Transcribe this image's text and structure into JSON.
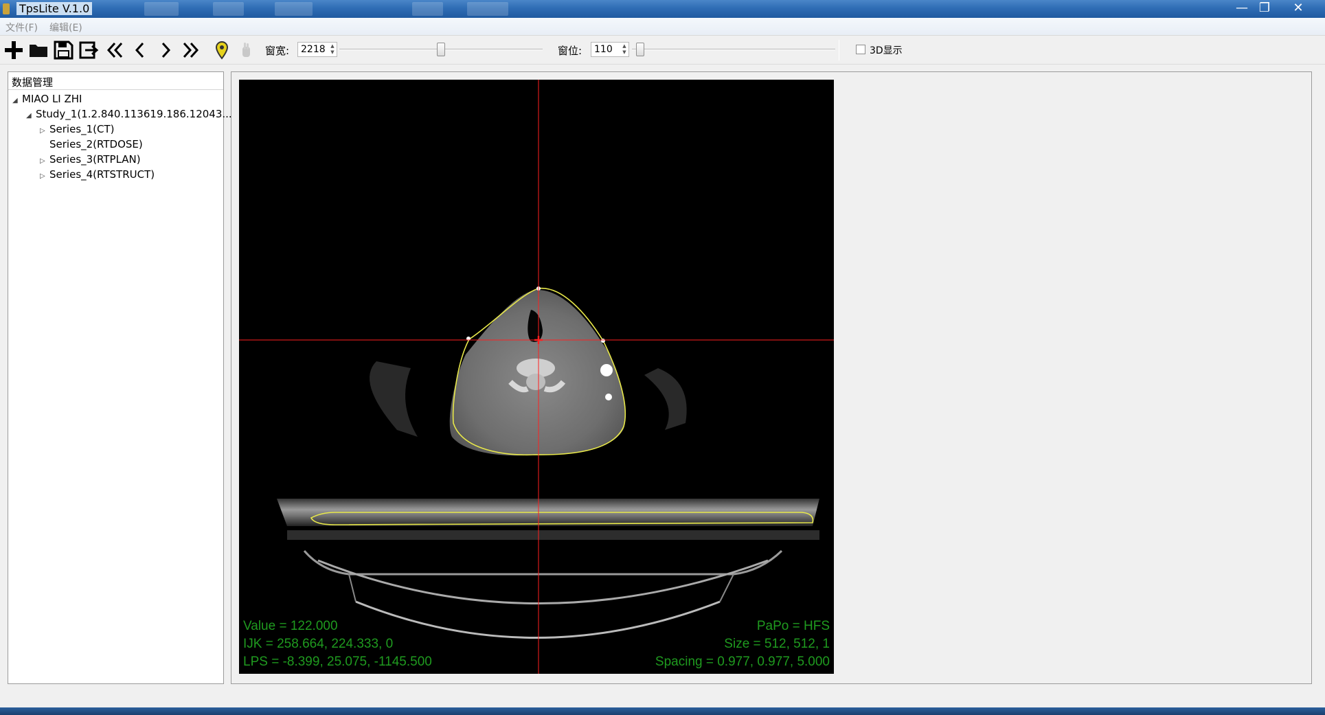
{
  "window": {
    "title": "TpsLite V.1.0",
    "controls": {
      "minimize": "—",
      "maximize": "❐",
      "close": "✕"
    }
  },
  "menu": {
    "items": [
      "文件(F)",
      "编辑(E)"
    ]
  },
  "toolbar": {
    "window_width_label": "窗宽:",
    "window_width_value": "2218",
    "window_width_slider": 0.5,
    "window_level_label": "窗位:",
    "window_level_value": "110",
    "window_level_slider": 0.02,
    "show3d_label": "3D显示",
    "show3d_checked": false,
    "icons": [
      "add-icon",
      "open-folder-icon",
      "save-icon",
      "export-icon",
      "first-icon",
      "previous-icon",
      "next-icon",
      "last-icon",
      "marker-icon",
      "hand-icon"
    ]
  },
  "data_panel": {
    "title": "数据管理",
    "patient": "MIAO LI ZHI",
    "study": "Study_1(1.2.840.113619.186.12043...",
    "series": [
      "Series_1(CT)",
      "Series_2(RTDOSE)",
      "Series_3(RTPLAN)",
      "Series_4(RTSTRUCT)"
    ]
  },
  "viewer": {
    "value": "Value = 122.000",
    "ijk": "IJK = 258.664, 224.333, 0",
    "lps": "LPS = -8.399, 25.075, -1145.500",
    "papo": "PaPo = HFS",
    "size": "Size = 512, 512, 1",
    "spacing": "Spacing = 0.977, 0.977, 5.000",
    "overlay_color": "#1f9a1f",
    "crosshair_color": "#ff2020",
    "contour_color": "#e8e84a"
  }
}
